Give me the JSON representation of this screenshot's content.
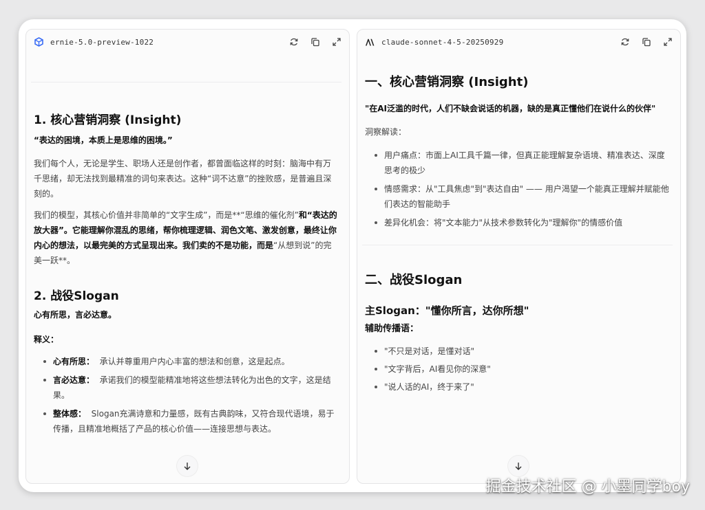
{
  "colors": {
    "accent": "#4a6cf7",
    "text": "#1f1f1f",
    "muted": "#444444",
    "background": "#fbfbfb"
  },
  "left_panel": {
    "model_name": "ernie-5.0-preview-1022",
    "model_icon": "ernie-cube-icon",
    "tools": [
      "refresh-icon",
      "copy-icon",
      "expand-icon"
    ],
    "section1": {
      "title": "1. 核心营销洞察 (Insight)",
      "quote": "“表达的困境，本质上是思维的困境。”",
      "para1": "我们每个人，无论是学生、职场人还是创作者，都曾面临这样的时刻：脑海中有万千思绪，却无法找到最精准的词句来表达。这种“词不达意”的挫败感，是普遍且深刻的。",
      "para2_a": "我们的模型，其核心价值并非简单的“文字生成”，而是**“思维的催化剂”",
      "para2_b": "和“表达的放大器”。它能理解你混乱的思绪，帮你梳理逻辑、润色文笔、激发创意，最终让你内心的想法，以最完美的方式呈现出来。我们卖的不是功能，而是",
      "para2_c": "“从想到说”的完美一跃**。"
    },
    "section2": {
      "title": "2. 战役Slogan",
      "slogan": "心有所思，言必达意。",
      "label": "释义：",
      "items": [
        {
          "term": "心有所思：",
          "text": "承认并尊重用户内心丰富的想法和创意，这是起点。"
        },
        {
          "term": "言必达意：",
          "text": "承诺我们的模型能精准地将这些想法转化为出色的文字，这是结果。"
        },
        {
          "term": "整体感：",
          "text": "Slogan充满诗意和力量感，既有古典韵味，又符合现代语境，易于传播，且精准地概括了产品的核心价值——连接思想与表达。"
        }
      ]
    }
  },
  "right_panel": {
    "model_name": "claude-sonnet-4-5-20250929",
    "model_icon": "anthropic-logo-icon",
    "tools": [
      "refresh-icon",
      "copy-icon",
      "expand-icon"
    ],
    "section1": {
      "title": "一、核心营销洞察 (Insight)",
      "quote": "\"在AI泛滥的时代，人们不缺会说话的机器，缺的是真正懂他们在说什么的伙伴\"",
      "label": "洞察解读：",
      "items": [
        "用户痛点：市面上AI工具千篇一律，但真正能理解复杂语境、精准表达、深度思考的极少",
        "情感需求：从\"工具焦虑\"到\"表达自由\" —— 用户渴望一个能真正理解并赋能他们表达的智能助手",
        "差异化机会：将\"文本能力\"从技术参数转化为\"理解你\"的情感价值"
      ]
    },
    "section2": {
      "title": "二、战役Slogan",
      "main_slogan": "主Slogan：\"懂你所言，达你所想\"",
      "sub_label": "辅助传播语：",
      "items": [
        "\"不只是对话，是懂对话\"",
        "\"文字背后，AI看见你的深意\"",
        "\"说人话的AI，终于来了\""
      ]
    }
  },
  "watermark": "掘金技术社区 @ 小墨同学boy"
}
